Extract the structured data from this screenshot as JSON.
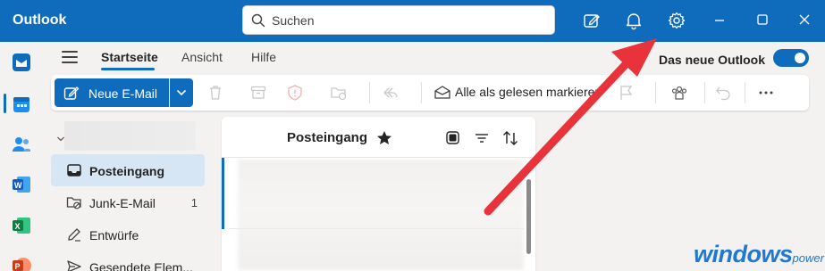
{
  "titlebar": {
    "app_name": "Outlook",
    "search_placeholder": "Suchen",
    "icons": [
      "compose-note-icon",
      "bell-icon",
      "gear-icon",
      "minimize-icon",
      "maximize-icon",
      "close-icon"
    ],
    "accent_color": "#0f6cbd"
  },
  "leftrail": {
    "apps": [
      "mail-icon",
      "calendar-icon",
      "people-icon",
      "word-icon",
      "excel-icon",
      "powerpoint-icon"
    ]
  },
  "tabs": {
    "items": [
      "Startseite",
      "Ansicht",
      "Hilfe"
    ],
    "active": "Startseite",
    "new_outlook_label": "Das neue Outlook",
    "new_outlook_enabled": true
  },
  "ribbon": {
    "new_mail_label": "Neue E-Mail",
    "mark_all_read_label": "Alle als gelesen markieren",
    "icons": [
      "delete-icon",
      "archive-icon",
      "report-icon",
      "move-folder-icon",
      "reply-icon",
      "mark-read-icon",
      "flag-icon",
      "group-icon",
      "undo-icon",
      "more-icon"
    ]
  },
  "folders": {
    "items": [
      {
        "label": "Posteingang",
        "icon": "inbox-icon",
        "selected": true,
        "count": ""
      },
      {
        "label": "Junk-E-Mail",
        "icon": "junk-icon",
        "selected": false,
        "count": "1"
      },
      {
        "label": "Entwürfe",
        "icon": "drafts-icon",
        "selected": false,
        "count": ""
      },
      {
        "label": "Gesendete Elem...",
        "icon": "sent-icon",
        "selected": false,
        "count": ""
      }
    ]
  },
  "message_list": {
    "title": "Posteingang",
    "icons": [
      "star-icon",
      "select-icon",
      "filter-icon",
      "sort-icon"
    ]
  },
  "watermark": {
    "main": "windows",
    "sub": "power"
  },
  "annotation": {
    "arrow_color": "#e8333a"
  }
}
